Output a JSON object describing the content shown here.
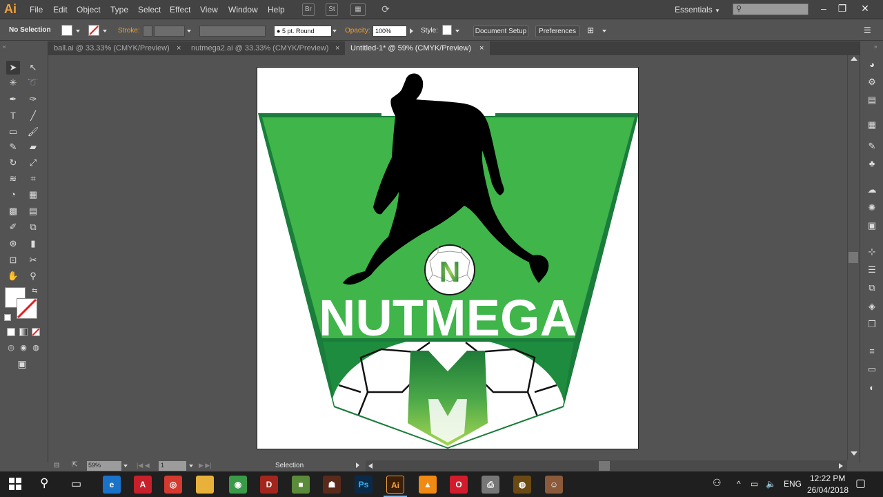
{
  "app": {
    "logo": "Ai"
  },
  "menu": [
    "File",
    "Edit",
    "Object",
    "Type",
    "Select",
    "Effect",
    "View",
    "Window",
    "Help"
  ],
  "menubar_icons": {
    "br": "Br",
    "st": "St"
  },
  "workspace": "Essentials",
  "control_bar": {
    "selection_status": "No Selection",
    "stroke_label": "Stroke:",
    "brush_value": "5 pt. Round",
    "opacity_label": "Opacity:",
    "opacity_value": "100%",
    "style_label": "Style:",
    "document_setup": "Document Setup",
    "preferences": "Preferences"
  },
  "tabs": [
    {
      "label": "ball.ai @ 33.33% (CMYK/Preview)",
      "active": false
    },
    {
      "label": "nutmega2.ai @ 33.33% (CMYK/Preview)",
      "active": false
    },
    {
      "label": "Untitled-1* @ 59% (CMYK/Preview)",
      "active": true
    }
  ],
  "tab_close_glyph": "×",
  "artwork": {
    "logo_text": "NUTMEGA",
    "ball_letter": "N",
    "shield_letter": "M",
    "colors": {
      "shield_light": "#3fb54a",
      "shield_dark": "#1d8a3c",
      "silhouette": "#000000",
      "text": "#ffffff"
    }
  },
  "status_bar": {
    "zoom": "59%",
    "artboard_number": "1",
    "tool": "Selection"
  },
  "taskbar": {
    "time": "12:22 PM",
    "date": "26/04/2018",
    "language": "ENG",
    "apps": [
      {
        "name": "edge",
        "label": "e",
        "color": "#1a73c9"
      },
      {
        "name": "acrobat",
        "label": "A",
        "color": "#c8202a"
      },
      {
        "name": "app-red",
        "label": "◎",
        "color": "#d43a2f"
      },
      {
        "name": "file-explorer",
        "label": "",
        "color": "#e8b23a"
      },
      {
        "name": "chrome",
        "label": "◉",
        "color": "#3a9a48"
      },
      {
        "name": "dota",
        "label": "D",
        "color": "#a2261c"
      },
      {
        "name": "minecraft",
        "label": "■",
        "color": "#5a8a3a"
      },
      {
        "name": "game",
        "label": "☗",
        "color": "#5a2a1a"
      },
      {
        "name": "photoshop",
        "label": "Ps",
        "color": "#0a2a48"
      },
      {
        "name": "illustrator",
        "label": "Ai",
        "color": "#3a1f0a"
      },
      {
        "name": "vlc",
        "label": "▲",
        "color": "#f08a12"
      },
      {
        "name": "opera",
        "label": "O",
        "color": "#d21c2b"
      },
      {
        "name": "printer",
        "label": "⎙",
        "color": "#777"
      },
      {
        "name": "gold-app",
        "label": "◍",
        "color": "#6a4a12"
      },
      {
        "name": "photo-app",
        "label": "☺",
        "color": "#8a5a3a"
      }
    ]
  }
}
